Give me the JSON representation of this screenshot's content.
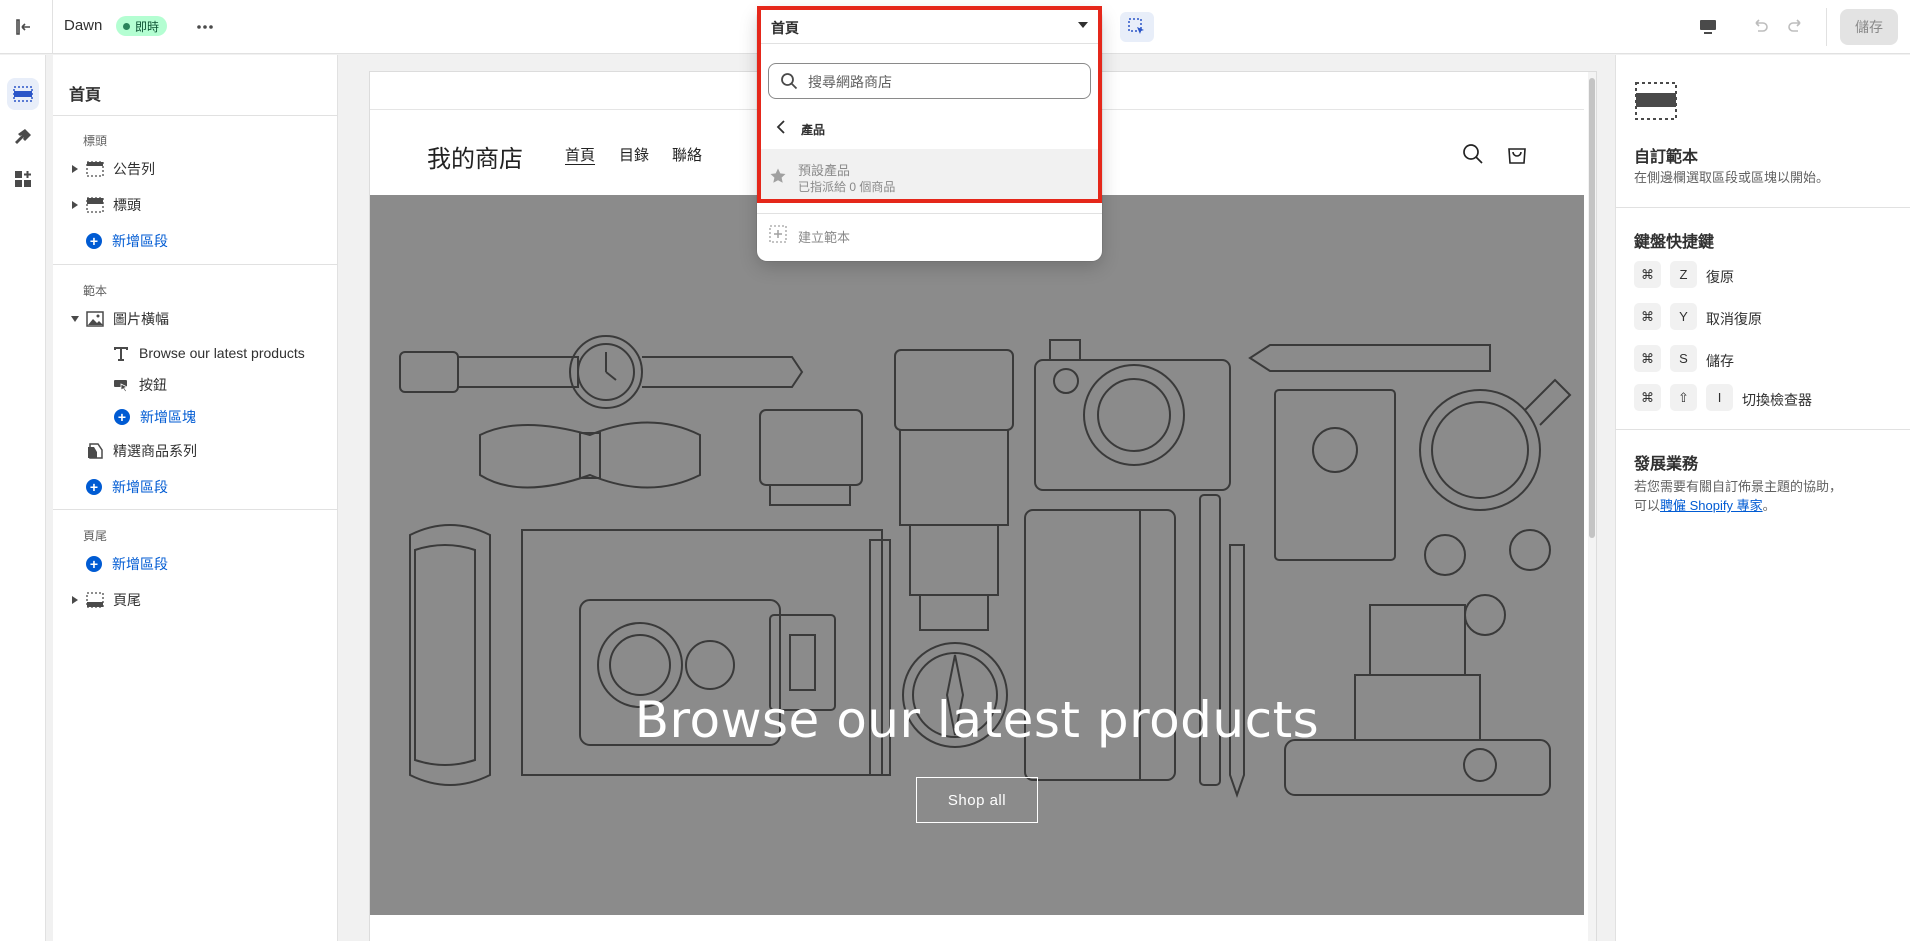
{
  "topbar": {
    "theme_name": "Dawn",
    "live_badge": "即時",
    "save_label": "儲存"
  },
  "template_picker": {
    "selected": "首頁",
    "search_placeholder": "搜尋網路商店",
    "back_label": "產品",
    "items": [
      {
        "title": "預設產品",
        "subtitle": "已指派給 0 個商品"
      }
    ],
    "create_label": "建立範本"
  },
  "left_panel": {
    "title": "首頁",
    "groups": {
      "header_label": "標頭",
      "template_label": "範本",
      "footer_label": "頁尾"
    },
    "header_items": [
      {
        "label": "公告列"
      },
      {
        "label": "標頭"
      }
    ],
    "add_section": "新增區段",
    "template_items": {
      "image_banner": "圖片橫幅",
      "banner_children": [
        "Browse our latest products",
        "按鈕"
      ],
      "add_block": "新增區塊",
      "featured_collection": "精選商品系列"
    },
    "footer_items": [
      {
        "label": "頁尾"
      }
    ]
  },
  "preview": {
    "store_name": "我的商店",
    "nav": [
      "首頁",
      "目錄",
      "聯絡"
    ],
    "hero_title": "Browse our latest products",
    "hero_button": "Shop all",
    "hero_bg": "#8b8b8b"
  },
  "right_panel": {
    "custom_title": "自訂範本",
    "custom_desc": "在側邊欄選取區段或區塊以開始。",
    "shortcuts_title": "鍵盤快捷鍵",
    "shortcuts": [
      {
        "keys": [
          "⌘",
          "Z"
        ],
        "label": "復原"
      },
      {
        "keys": [
          "⌘",
          "Y"
        ],
        "label": "取消復原"
      },
      {
        "keys": [
          "⌘",
          "S"
        ],
        "label": "儲存"
      },
      {
        "keys": [
          "⌘",
          "⇧",
          "I"
        ],
        "label": "切換檢查器"
      }
    ],
    "grow_title": "發展業務",
    "grow_desc1": "若您需要有關自訂佈景主題的協助，",
    "grow_desc2_prefix": "可以",
    "grow_link": "聘僱 Shopify 專家",
    "grow_desc2_suffix": "。"
  },
  "colors": {
    "accent": "#005bd3",
    "highlight": "#e5271a",
    "live": "#b4fed2"
  }
}
